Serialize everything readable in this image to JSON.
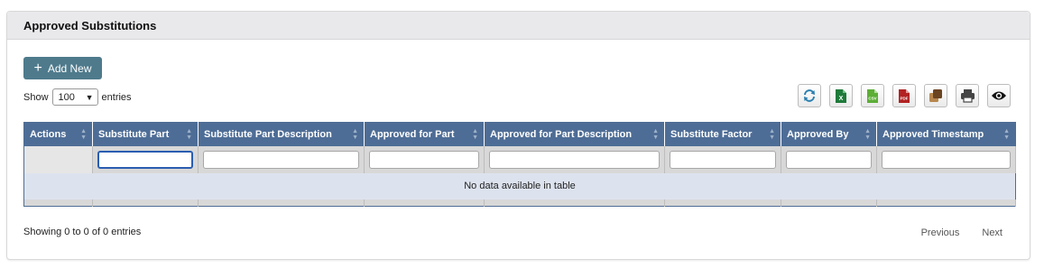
{
  "panel": {
    "title": "Approved Substitutions"
  },
  "toolbar": {
    "add_label": "Add New",
    "show_label": "Show",
    "entries_value": "100",
    "entries_label": "entries",
    "tools": [
      {
        "name": "refresh-icon",
        "color": "#2a7fb0"
      },
      {
        "name": "excel-icon",
        "color": "#1e7a3a",
        "text": "X"
      },
      {
        "name": "csv-icon",
        "color": "#5cae36",
        "text": "CSV"
      },
      {
        "name": "pdf-icon",
        "color": "#b22222",
        "text": "PDF"
      },
      {
        "name": "copy-icon",
        "color": "#8a5a2b"
      },
      {
        "name": "print-icon",
        "color": "#444444"
      },
      {
        "name": "eye-icon",
        "color": "#111111"
      }
    ]
  },
  "table": {
    "header_color": "#4e6d96",
    "columns": [
      "Actions",
      "Substitute Part",
      "Substitute Part Description",
      "Approved for Part",
      "Approved for Part Description",
      "Substitute Factor",
      "Approved By",
      "Approved Timestamp"
    ],
    "empty_message": "No data available in table"
  },
  "footer": {
    "info": "Showing 0 to 0 of 0 entries",
    "previous_label": "Previous",
    "next_label": "Next"
  }
}
